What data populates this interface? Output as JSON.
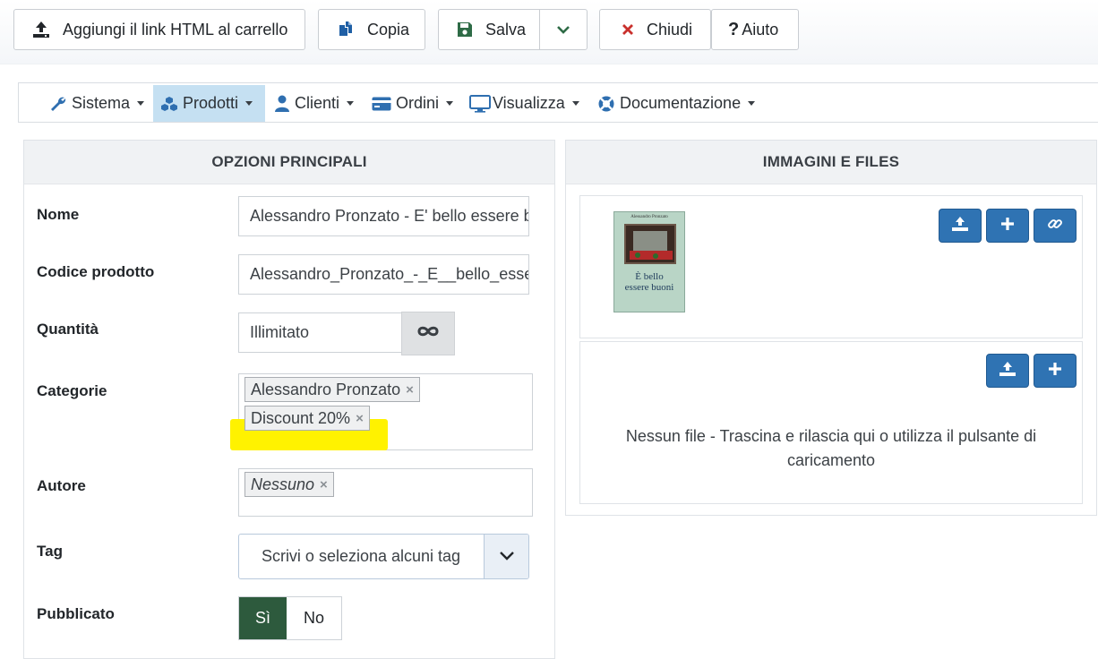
{
  "toolbar": {
    "add_html_link_label": "Aggiungi il link HTML al carrello",
    "copy_label": "Copia",
    "save_label": "Salva",
    "close_label": "Chiudi",
    "help_label": "Aiuto"
  },
  "nav": {
    "items": [
      {
        "label": "Sistema",
        "icon": "wrench-icon"
      },
      {
        "label": "Prodotti",
        "icon": "cubes-icon",
        "active": true
      },
      {
        "label": "Clienti",
        "icon": "user-icon"
      },
      {
        "label": "Ordini",
        "icon": "credit-card-icon"
      },
      {
        "label": "Visualizza",
        "icon": "desktop-icon"
      },
      {
        "label": "Documentazione",
        "icon": "life-ring-icon"
      }
    ]
  },
  "main_options": {
    "title": "OPZIONI PRINCIPALI",
    "name_label": "Nome",
    "name_value": "Alessandro Pronzato - E' bello essere buoni",
    "code_label": "Codice prodotto",
    "code_value": "Alessandro_Pronzato_-_E__bello_essere_buoni",
    "quantity_label": "Quantità",
    "quantity_value": "Illimitato",
    "categories_label": "Categorie",
    "categories": [
      "Alessandro Pronzato",
      "Discount 20%"
    ],
    "author_label": "Autore",
    "author_value": "Nessuno",
    "tag_label": "Tag",
    "tag_placeholder": "Scrivi o seleziona alcuni tag",
    "published_label": "Pubblicato",
    "published_yes": "Sì",
    "published_no": "No",
    "published_value": "Sì"
  },
  "images_files": {
    "title": "IMMAGINI E FILES",
    "book_cover": {
      "author": "Alessandro Pronzato",
      "title_line1": "È bello",
      "title_line2": "essere buoni"
    },
    "no_file_message": "Nessun file - Trascina e rilascia qui o utilizza il pulsante di caricamento"
  },
  "colors": {
    "accent_blue": "#2f73b3",
    "nav_active": "#c5e0f2",
    "published_yes_bg": "#2d5a3d",
    "save_icon": "#2e6b46",
    "close_icon": "#c9302c",
    "highlight": "#fff200"
  }
}
